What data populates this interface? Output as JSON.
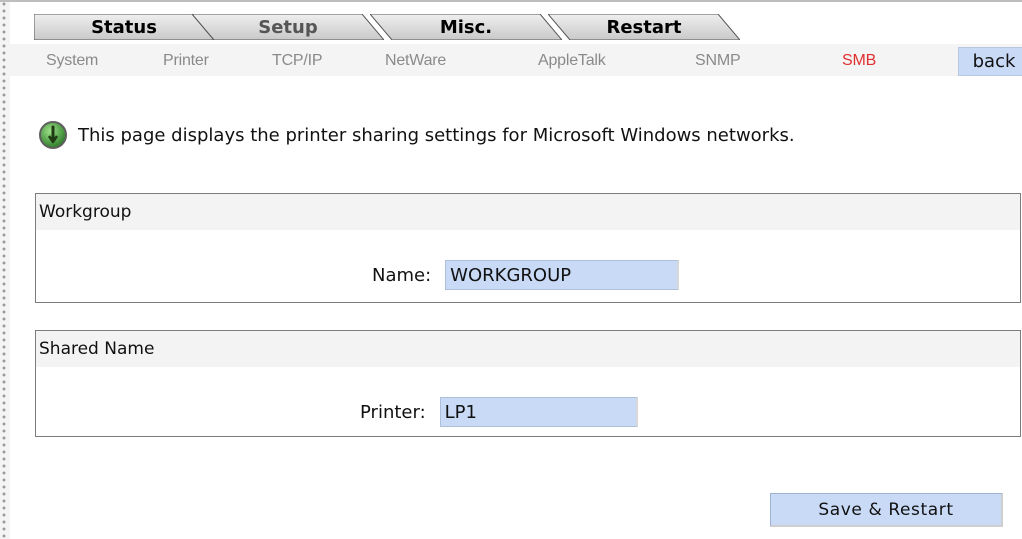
{
  "tabs": {
    "status": "Status",
    "setup": "Setup",
    "misc": "Misc.",
    "restart": "Restart"
  },
  "subnav": {
    "items": [
      "System",
      "Printer",
      "TCP/IP",
      "NetWare",
      "AppleTalk",
      "SNMP",
      "SMB"
    ],
    "active": "SMB",
    "back_label": "back"
  },
  "info": {
    "icon": "info-icon",
    "text": "This page displays the printer sharing settings for Microsoft Windows networks."
  },
  "workgroup": {
    "header": "Workgroup",
    "name_label": "Name:",
    "name_value": "WORKGROUP"
  },
  "shared": {
    "header": "Shared Name",
    "printer_label": "Printer:",
    "printer_value": "LP1"
  },
  "actions": {
    "save_label": "Save & Restart"
  },
  "colors": {
    "active_subnav": "#e0302e",
    "input_bg": "#c9daf6",
    "tab_fill": "#d9d9d9"
  }
}
